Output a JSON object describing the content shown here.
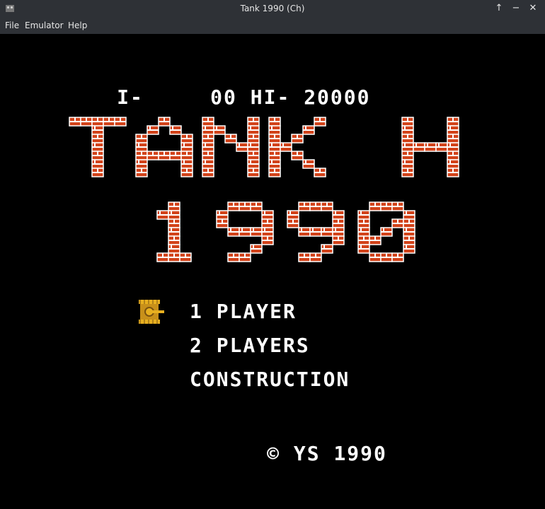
{
  "window": {
    "title": "Tank 1990 (Ch)"
  },
  "menubar": {
    "file": "File",
    "emulator": "Emulator",
    "help": "Help"
  },
  "hud": {
    "player_label": "I-",
    "player_score": "00",
    "hi_label": "HI-",
    "hi_score": "20000"
  },
  "logo": {
    "line1": "TANK H",
    "line2": "1990",
    "brick_color": "#d2431a",
    "mortar_color": "#ffffff"
  },
  "menu": {
    "options": [
      "1 PLAYER",
      "2 PLAYERS",
      "CONSTRUCTION"
    ],
    "selected_index": 0
  },
  "copyright": {
    "symbol": "©",
    "text": "YS 1990"
  },
  "colors": {
    "background": "#000000",
    "text": "#ffffff",
    "cursor_tank": "#e8b020"
  },
  "icons": {
    "cursor": "tank-cursor-icon"
  }
}
